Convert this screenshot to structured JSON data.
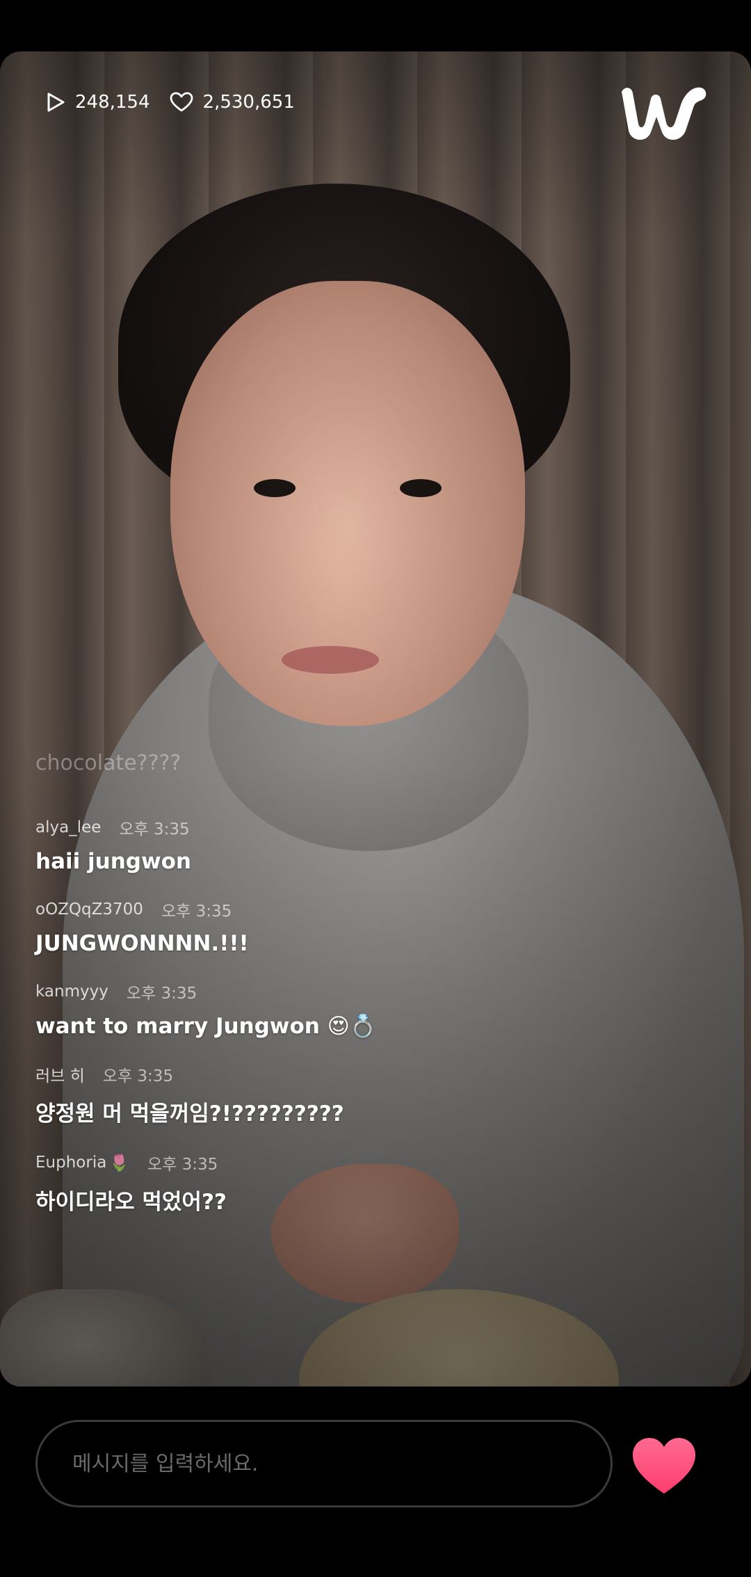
{
  "stats": {
    "plays": "248,154",
    "likes": "2,530,651"
  },
  "logo": {
    "icon": "weverse-logo-icon"
  },
  "chat": {
    "fading_message": "chocolate????",
    "messages": [
      {
        "user": "alya_lee",
        "time": "오후 3:35",
        "text": "haii jungwon"
      },
      {
        "user": "oOZQqZ3700",
        "time": "오후 3:35",
        "text": "JUNGWONNNN.!!!"
      },
      {
        "user": "kanmyyy",
        "time": "오후 3:35",
        "text": "want to marry Jungwon",
        "emoji": "😍💍"
      },
      {
        "user": "러브 히",
        "time": "오후 3:35",
        "text": "양정원 머 먹을꺼임?!?????????"
      },
      {
        "user": "Euphoria",
        "user_emoji": "🌷",
        "time": "오후 3:35",
        "text": "하이디라오 먹었어??"
      }
    ]
  },
  "input": {
    "placeholder": "메시지를 입력하세요."
  },
  "colors": {
    "heart": "#ff4d7a",
    "background": "#000000"
  }
}
